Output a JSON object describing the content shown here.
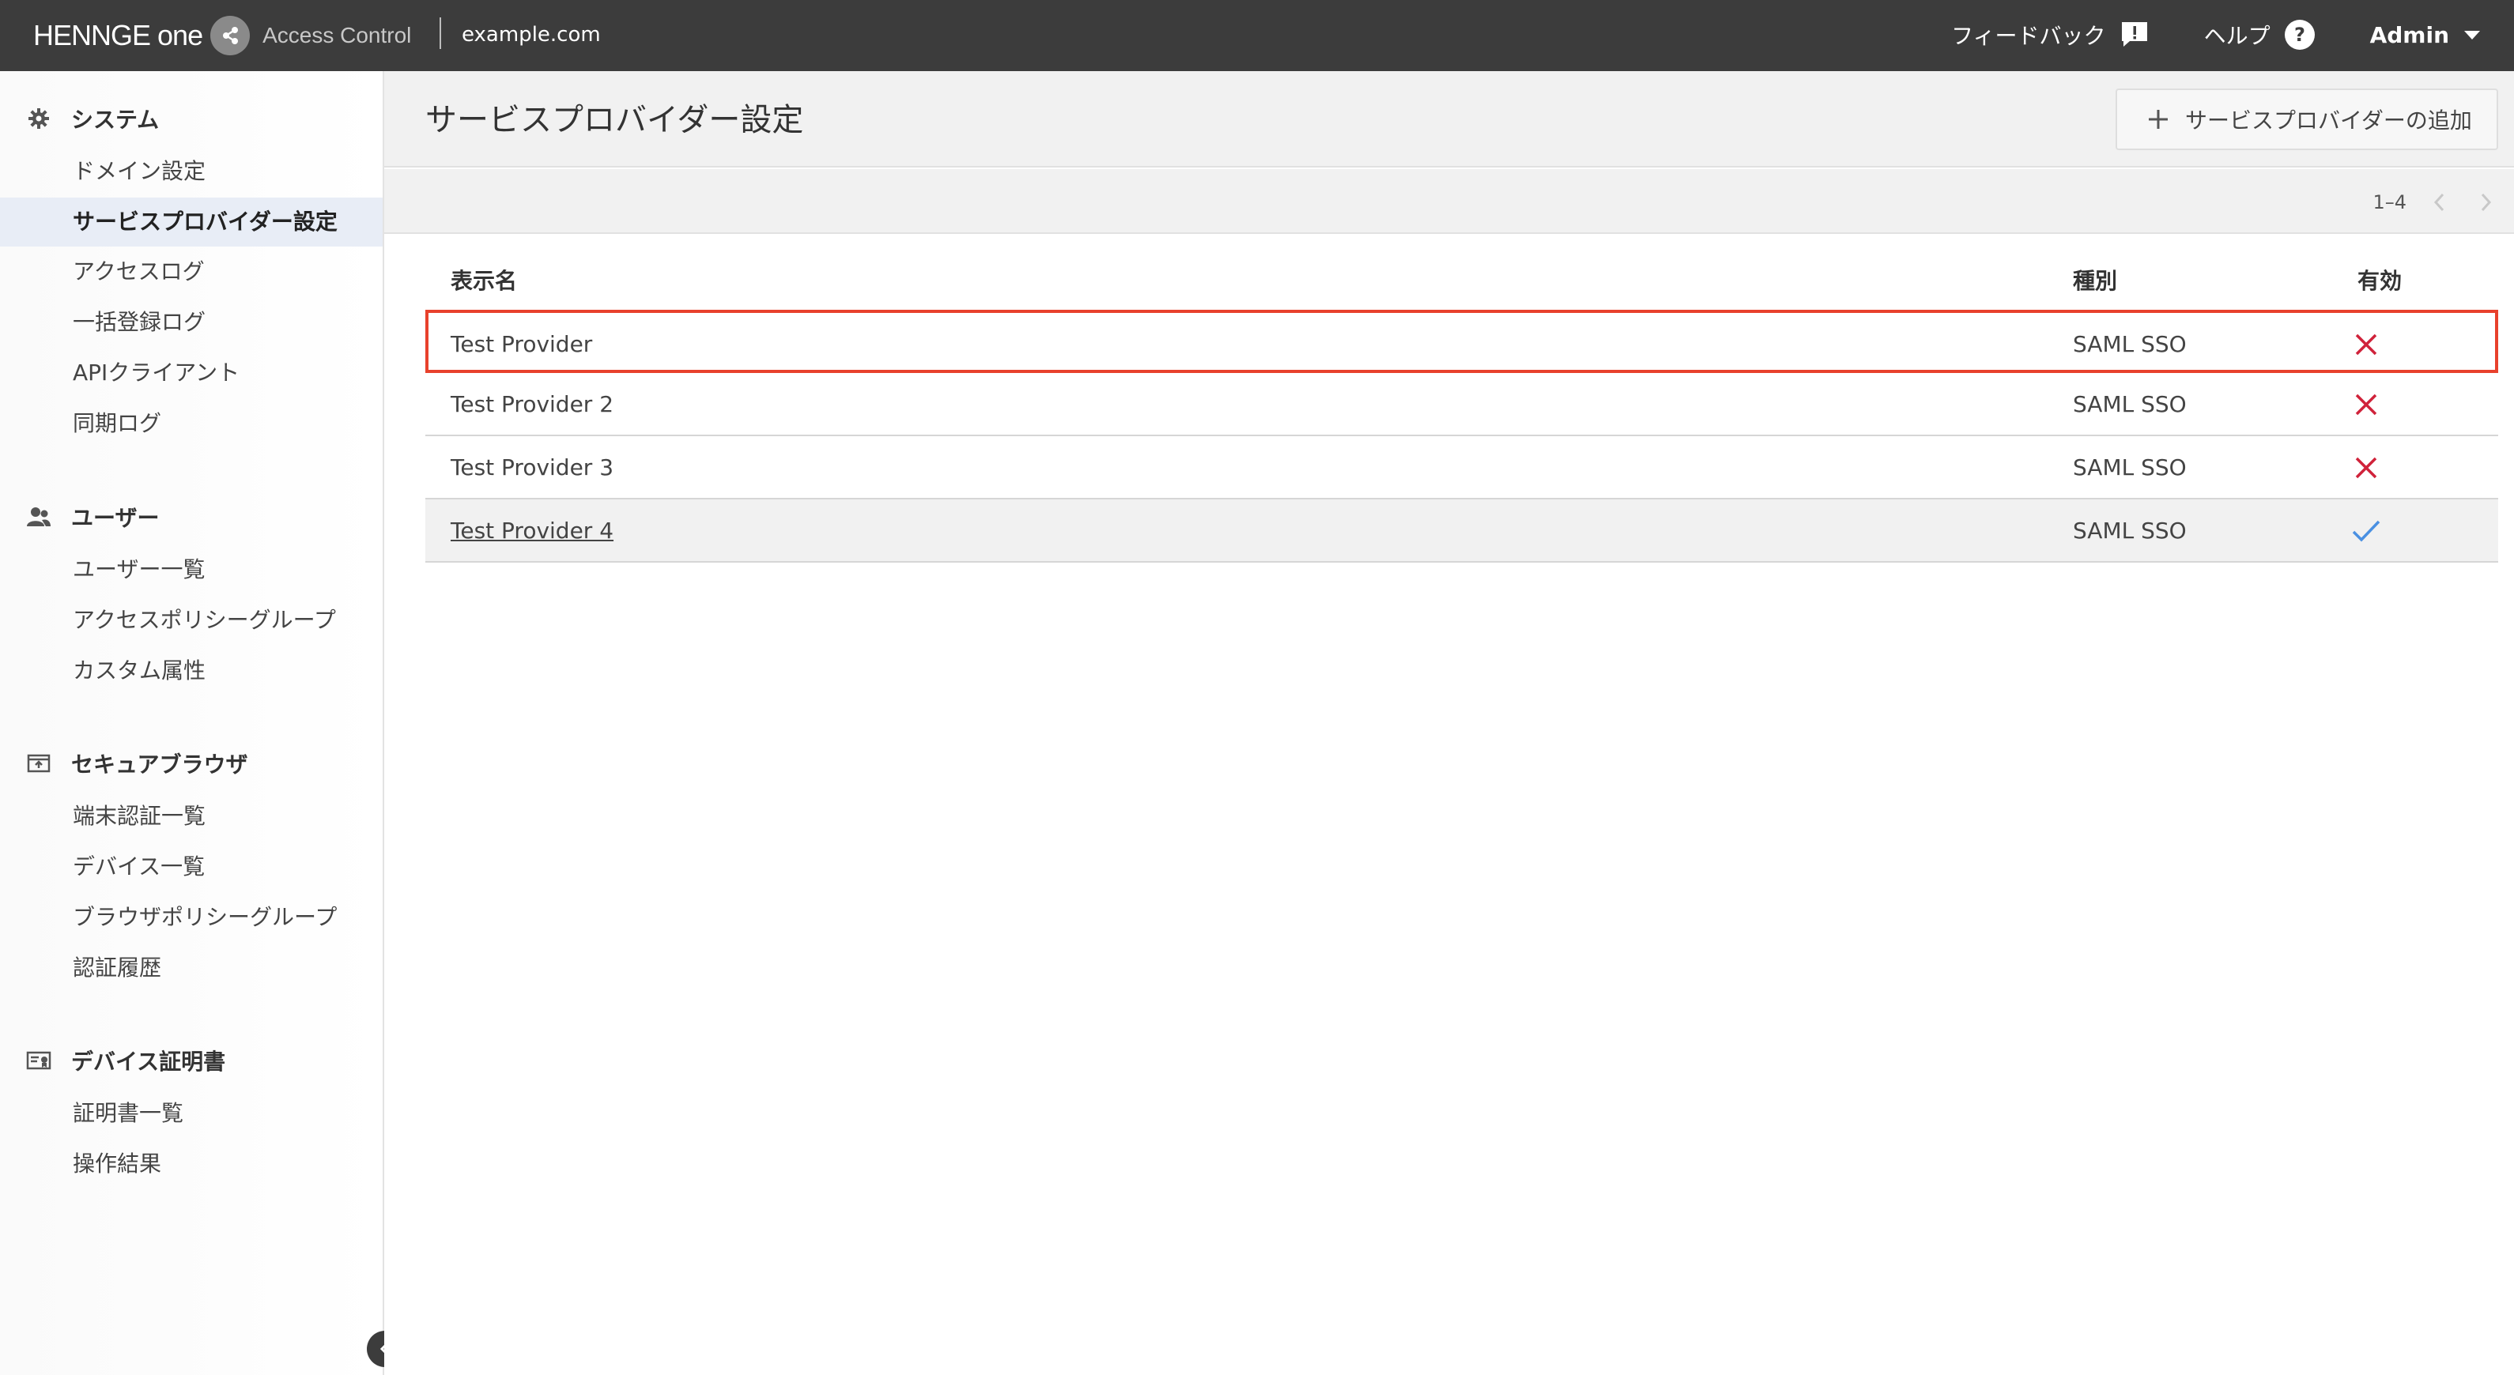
{
  "colors": {
    "topbar": "#3c3c3c",
    "accent_active": "#e8edf6",
    "disabled_x": "#d0223a",
    "enabled_check": "#4a90e2",
    "highlight_border": "#e8412c"
  },
  "header": {
    "brand_name": "HENNGE one",
    "product": "Access Control",
    "domain": "example.com",
    "feedback_label": "フィードバック",
    "feedback_icon": "feedback-icon",
    "help_label": "ヘルプ",
    "help_icon": "help-icon",
    "user_label": "Admin",
    "user_icon": "caret-down-icon"
  },
  "sidebar": {
    "groups": [
      {
        "title": "システム",
        "icon": "gear-icon",
        "items": [
          {
            "label": "ドメイン設定"
          },
          {
            "label": "サービスプロバイダー設定",
            "active": true
          },
          {
            "label": "アクセスログ"
          },
          {
            "label": "一括登録ログ"
          },
          {
            "label": "APIクライアント"
          },
          {
            "label": "同期ログ"
          }
        ]
      },
      {
        "title": "ユーザー",
        "icon": "users-icon",
        "items": [
          {
            "label": "ユーザー一覧"
          },
          {
            "label": "アクセスポリシーグループ"
          },
          {
            "label": "カスタム属性"
          }
        ]
      },
      {
        "title": "セキュアブラウザ",
        "icon": "browser-icon",
        "items": [
          {
            "label": "端末認証一覧"
          },
          {
            "label": "デバイス一覧"
          },
          {
            "label": "ブラウザポリシーグループ"
          },
          {
            "label": "認証履歴"
          }
        ]
      },
      {
        "title": "デバイス証明書",
        "icon": "certificate-icon",
        "items": [
          {
            "label": "証明書一覧"
          },
          {
            "label": "操作結果"
          }
        ]
      }
    ]
  },
  "main": {
    "title": "サービスプロバイダー設定",
    "add_button_label": "サービスプロバイダーの追加",
    "pager": {
      "range": "1–4"
    },
    "table": {
      "columns": [
        "表示名",
        "種別",
        "有効"
      ],
      "rows": [
        {
          "name": "Test Provider",
          "type": "SAML SSO",
          "enabled": false
        },
        {
          "name": "Test Provider 2",
          "type": "SAML SSO",
          "enabled": false
        },
        {
          "name": "Test Provider 3",
          "type": "SAML SSO",
          "enabled": false
        },
        {
          "name": "Test Provider 4",
          "type": "SAML SSO",
          "enabled": true
        }
      ]
    }
  }
}
